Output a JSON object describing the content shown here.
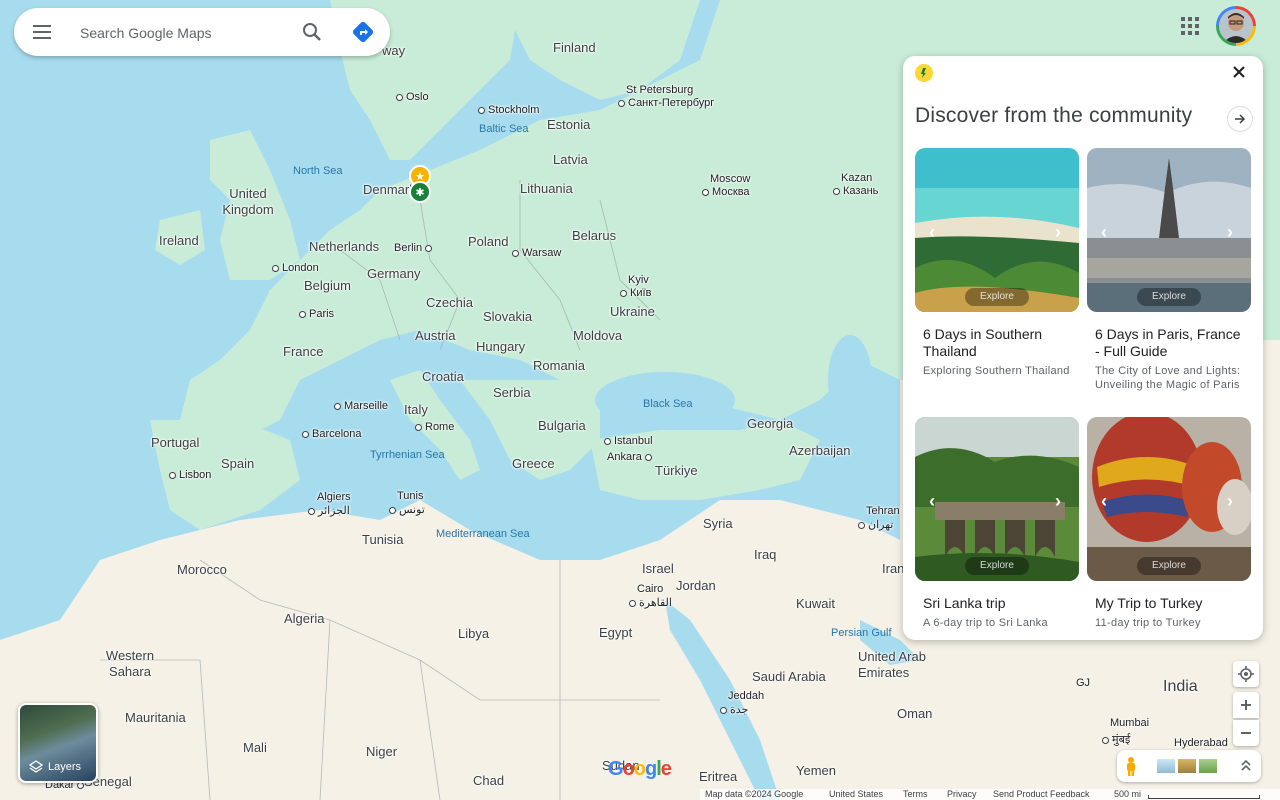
{
  "search": {
    "placeholder": "Search Google Maps"
  },
  "panel": {
    "title": "Discover from the community",
    "cards": [
      {
        "title": "6 Days in Southern Thailand",
        "description": "Exploring Southern Thailand",
        "explore": "Explore"
      },
      {
        "title": "6 Days in Paris, France - Full Guide",
        "description": "The City of Love and Lights: Unveiling the Magic of Paris",
        "explore": "Explore"
      },
      {
        "title": "Sri Lanka trip",
        "description": "A 6-day trip to Sri Lanka",
        "explore": "Explore"
      },
      {
        "title": "My Trip to Turkey",
        "description": "11-day trip to Turkey",
        "explore": "Explore"
      }
    ]
  },
  "map": {
    "countries": [
      "Finland",
      "Estonia",
      "Latvia",
      "Lithuania",
      "Denmark",
      "United Kingdom",
      "Ireland",
      "Netherlands",
      "Germany",
      "Poland",
      "Belarus",
      "Belgium",
      "Czechia",
      "Slovakia",
      "Ukraine",
      "France",
      "Austria",
      "Hungary",
      "Moldova",
      "Croatia",
      "Romania",
      "Serbia",
      "Italy",
      "Bulgaria",
      "Portugal",
      "Spain",
      "Greece",
      "Georgia",
      "Azerbaijan",
      "Türkiye",
      "Syria",
      "Iraq",
      "Tunisia",
      "Morocco",
      "Algeria",
      "Libya",
      "Egypt",
      "Israel",
      "Jordan",
      "Kuwait",
      "Saudi Arabia",
      "United Arab Emirates",
      "Oman",
      "Yemen",
      "Western Sahara",
      "Mauritania",
      "Mali",
      "Niger",
      "Chad",
      "Eritrea",
      "Senegal",
      "India",
      "Iran",
      "Sudan"
    ],
    "cities": [
      "Oslo",
      "Stockholm",
      "St Petersburg",
      "Санкт-Петербург",
      "Moscow",
      "Москва",
      "Kazan",
      "Казань",
      "Berlin",
      "Warsaw",
      "London",
      "Kyiv",
      "Київ",
      "Paris",
      "Marseille",
      "Rome",
      "Barcelona",
      "Lisbon",
      "Istanbul",
      "Ankara",
      "Algiers",
      "الجزائر",
      "Tunis",
      "تونس",
      "Cairo",
      "القاهرة",
      "Jeddah",
      "جدة",
      "Tehran",
      "تهران",
      "Mumbai",
      "मुंबई",
      "Hyderabad",
      "Dakar"
    ],
    "seas": [
      "North Sea",
      "Baltic Sea",
      "Black Sea",
      "Tyrrhenian Sea",
      "Mediterranean Sea",
      "Persian Gulf"
    ],
    "partial_labels": [
      "way",
      "GJ"
    ]
  },
  "controls": {
    "layers_label": "Layers"
  },
  "footer": {
    "map_data": "Map data ©2024 Google",
    "region": "United States",
    "terms": "Terms",
    "privacy": "Privacy",
    "feedback": "Send Product Feedback",
    "scale": "500 mi"
  },
  "colors": {
    "water": "#a7dcef",
    "land": "#c8ecd7",
    "desert": "#f5f1e6",
    "accent": "#1a73e8"
  }
}
